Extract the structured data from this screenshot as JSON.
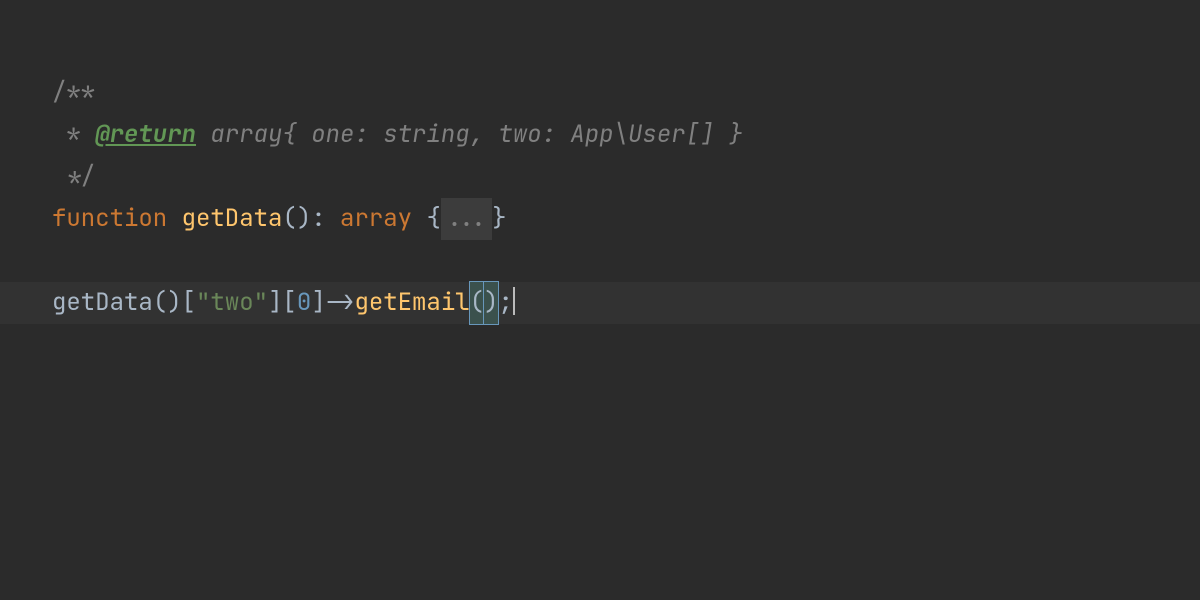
{
  "code": {
    "line1": {
      "comment_open": "/**"
    },
    "line2": {
      "prefix": " * ",
      "tag": "@return",
      "rest": " array{ one: string, two: App\\User[] }"
    },
    "line3": {
      "comment_close": " */"
    },
    "line4": {
      "keyword": "function",
      "space1": " ",
      "name": "getData",
      "parens": "()",
      "colon": ": ",
      "returnType": "array",
      "space2": " ",
      "braceOpen": "{",
      "folded": "...",
      "braceClose": "}"
    },
    "line6": {
      "call": "getData",
      "p1": "()[",
      "str": "\"two\"",
      "p2": "][",
      "num": "0",
      "p3": "]->",
      "method": "getEmail",
      "openParen": "(",
      "closeParen": ")",
      "semi": ";"
    }
  }
}
